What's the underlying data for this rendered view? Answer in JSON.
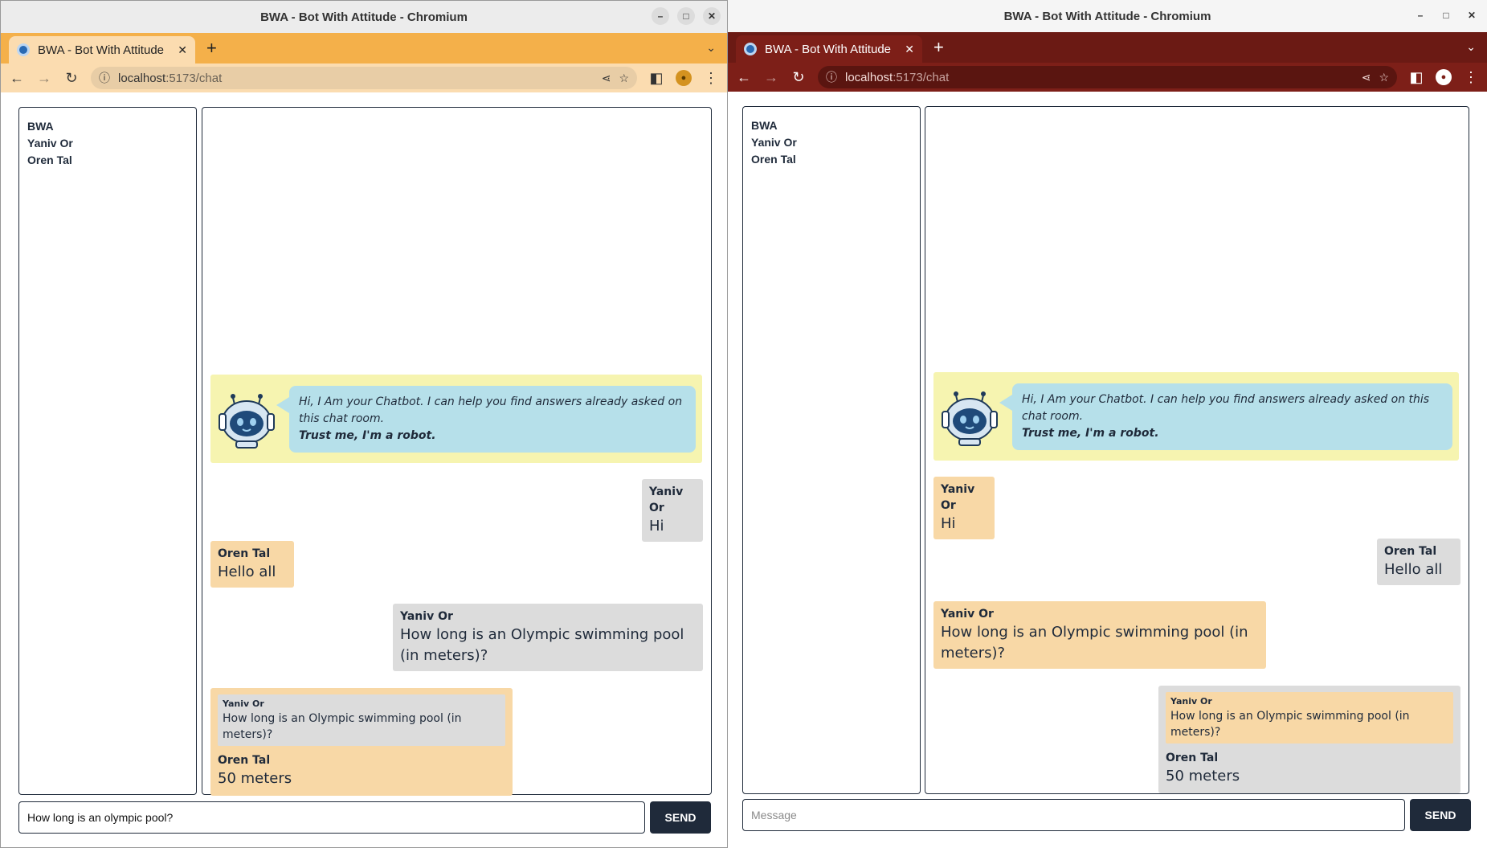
{
  "colors": {
    "left_accent": "#f4b04a",
    "right_accent": "#6b1a14",
    "panel_border": "#1f2a3a",
    "bot_bg": "#f6f4b0",
    "bot_bubble": "#b6e0ea",
    "gray_bubble": "#dcdcdc",
    "peach_bubble": "#f8d8a6"
  },
  "left": {
    "window_title": "BWA - Bot With Attitude - Chromium",
    "tab_title": "BWA - Bot With Attitude",
    "url_host": "localhost",
    "url_path": ":5173/chat",
    "users": [
      "BWA",
      "Yaniv Or",
      "Oren Tal"
    ],
    "bot": {
      "line1": "Hi, I Am your Chatbot. I can help you find answers already asked on this chat room.",
      "line2": "Trust me, I'm a robot."
    },
    "messages": [
      {
        "sender": "Yaniv Or",
        "text": "Hi"
      },
      {
        "sender": "Oren Tal",
        "text": "Hello all"
      },
      {
        "sender": "Yaniv Or",
        "text": "How long is an Olympic swimming pool (in meters)?"
      },
      {
        "quote_sender": "Yaniv Or",
        "quote_text": "How long is an Olympic swimming pool (in meters)?",
        "sender": "Oren Tal",
        "text": "50 meters"
      }
    ],
    "input_value": "How long is an olympic pool?",
    "send_label": "SEND"
  },
  "right": {
    "window_title": "BWA - Bot With Attitude - Chromium",
    "tab_title": "BWA - Bot With Attitude",
    "url_host": "localhost",
    "url_path": ":5173/chat",
    "users": [
      "BWA",
      "Yaniv Or",
      "Oren Tal"
    ],
    "bot": {
      "line1": "Hi, I Am your Chatbot. I can help you find answers already asked on this chat room.",
      "line2": "Trust me, I'm a robot."
    },
    "messages": [
      {
        "sender": "Yaniv Or",
        "text": "Hi"
      },
      {
        "sender": "Oren Tal",
        "text": "Hello all"
      },
      {
        "sender": "Yaniv Or",
        "text": "How long is an Olympic swimming pool (in meters)?"
      },
      {
        "quote_sender": "Yaniv Or",
        "quote_text": "How long is an Olympic swimming pool (in meters)?",
        "sender": "Oren Tal",
        "text": "50 meters"
      }
    ],
    "input_placeholder": "Message",
    "send_label": "SEND"
  }
}
